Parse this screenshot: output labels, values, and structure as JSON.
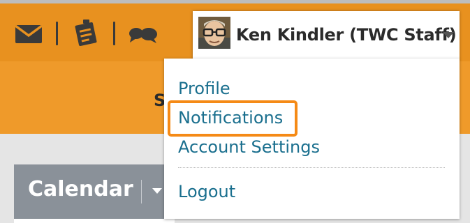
{
  "header": {
    "icons": [
      "mail-icon",
      "clipboard-icon",
      "chat-bubbles-icon"
    ],
    "icon_color": "#3a3a3a",
    "bar_color": "#e8911f"
  },
  "user_menu": {
    "name": "Ken Kindler (TWC Staff)",
    "avatar": "avatar-icon",
    "caret": "chevron-down-icon"
  },
  "dropdown": {
    "items": [
      {
        "label": "Profile",
        "highlighted": false
      },
      {
        "label": "Notifications",
        "highlighted": true
      },
      {
        "label": "Account Settings",
        "highlighted": false
      },
      {
        "label": "Logout",
        "highlighted": false
      }
    ],
    "link_color": "#1a6f8e",
    "highlight_color": "#f58a16"
  },
  "partial": {
    "band_text": "S"
  },
  "calendar": {
    "title": "Calendar"
  }
}
